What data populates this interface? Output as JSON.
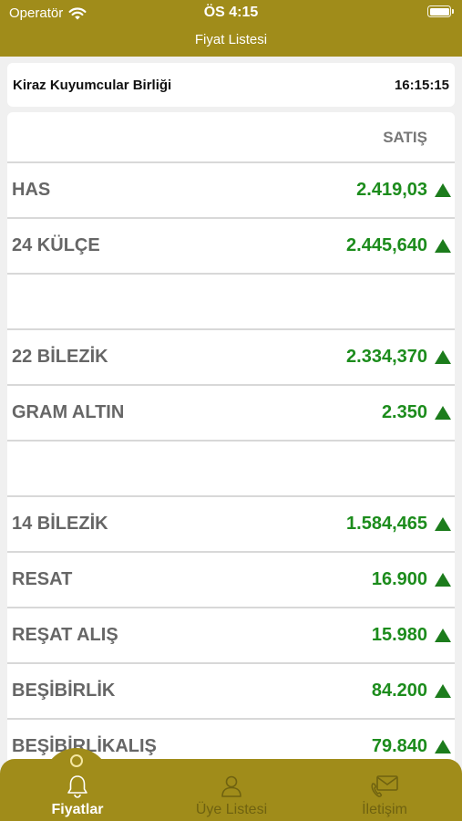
{
  "status_bar": {
    "carrier": "Operatör",
    "time": "ÖS 4:15"
  },
  "nav": {
    "title": "Fiyat Listesi"
  },
  "info": {
    "company": "Kiraz Kuyumcular Birliği",
    "time": "16:15:15"
  },
  "list": {
    "column_header": "SATIŞ",
    "trend_icon": "up-arrow-icon",
    "rows": [
      {
        "name": "HAS",
        "value": "2.419,03",
        "trend": "up"
      },
      {
        "name": "24 KÜLÇE",
        "value": "2.445,640",
        "trend": "up"
      },
      {
        "name": "",
        "value": "",
        "trend": ""
      },
      {
        "name": "22 BİLEZİK",
        "value": "2.334,370",
        "trend": "up"
      },
      {
        "name": "GRAM ALTIN",
        "value": "2.350",
        "trend": "up"
      },
      {
        "name": "",
        "value": "",
        "trend": ""
      },
      {
        "name": "14 BİLEZİK",
        "value": "1.584,465",
        "trend": "up"
      },
      {
        "name": "RESAT",
        "value": "16.900",
        "trend": "up"
      },
      {
        "name": "REŞAT ALIŞ",
        "value": "15.980",
        "trend": "up"
      },
      {
        "name": "BEŞİBİRLİK",
        "value": "84.200",
        "trend": "up"
      },
      {
        "name": "BEŞİBİRLİKALIŞ",
        "value": "79.840",
        "trend": "up"
      }
    ]
  },
  "tabs": [
    {
      "label": "Fiyatlar",
      "icon": "bell-icon",
      "active": true
    },
    {
      "label": "Üye Listesi",
      "icon": "user-icon",
      "active": false
    },
    {
      "label": "İletişim",
      "icon": "contact-icon",
      "active": false
    }
  ],
  "colors": {
    "brand": "#a08c1a",
    "price_up": "#1c8c1c",
    "background": "#f0f0f0"
  }
}
